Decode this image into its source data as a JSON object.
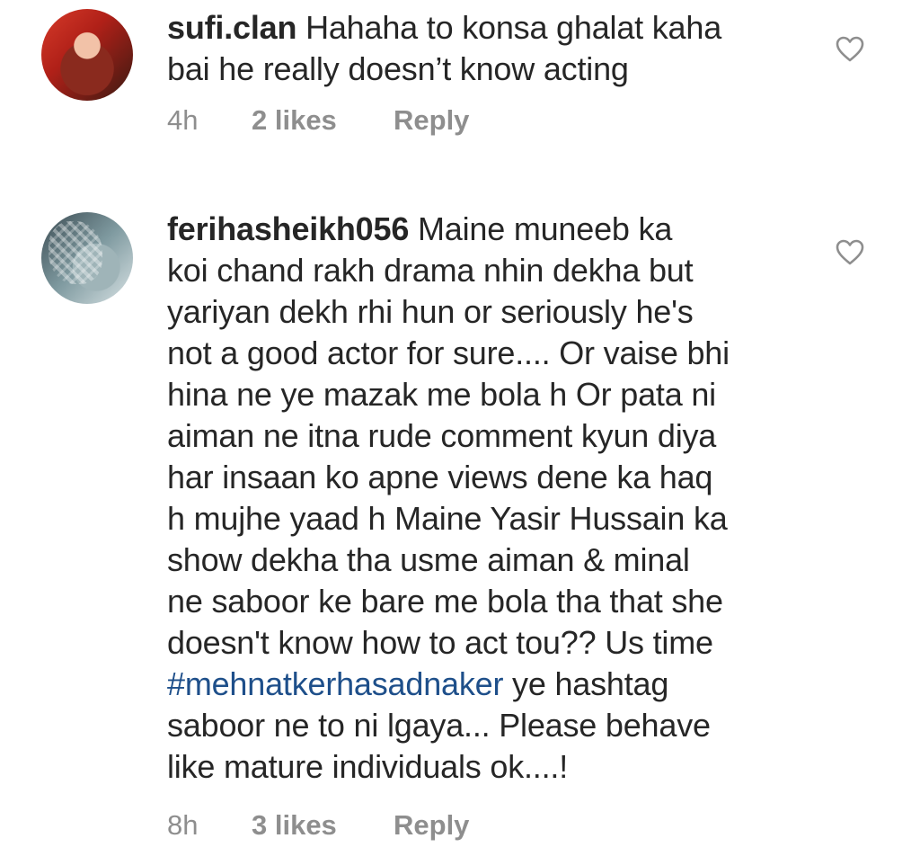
{
  "comments": [
    {
      "username": "sufi.clan",
      "text": "Hahaha to konsa ghalat kaha bai he really doesn’t know acting",
      "lines": [
        "Hahaha to konsa ghalat kaha",
        "bai he really doesn’t know acting"
      ],
      "time": "4h",
      "likes": "2 likes",
      "reply": "Reply",
      "avatar_icon": "profile-photo-woman"
    },
    {
      "username": "ferihasheikh056",
      "lines": [
        "Maine muneeb ka",
        "koi chand rakh drama nhin dekha but",
        "yariyan dekh rhi hun or seriously he's",
        "not a good actor for sure.... Or vaise bhi",
        "hina ne ye mazak me bola h Or pata ni",
        "aiman ne itna rude comment kyun diya",
        "har insaan ko apne views dene ka haq",
        "h mujhe yaad h Maine Yasir Hussain ka",
        "show dekha tha usme aiman & minal",
        "ne saboor ke bare me bola tha that she",
        "doesn't know how to act tou?? Us time"
      ],
      "hashtag": "#mehnatkerhasadnaker",
      "after_hashtag": " ye hashtag",
      "tail_lines": [
        "saboor ne to ni lgaya... Please behave",
        "like mature individuals ok....!"
      ],
      "time": "8h",
      "likes": "3 likes",
      "reply": "Reply",
      "avatar_icon": "profile-photo-pattern"
    }
  ],
  "colors": {
    "text": "#262626",
    "meta": "#8e8e8e",
    "hashtag": "#1e4f8a",
    "heart_stroke": "#8e8e8e"
  },
  "icons": {
    "like": "heart-outline-icon"
  }
}
